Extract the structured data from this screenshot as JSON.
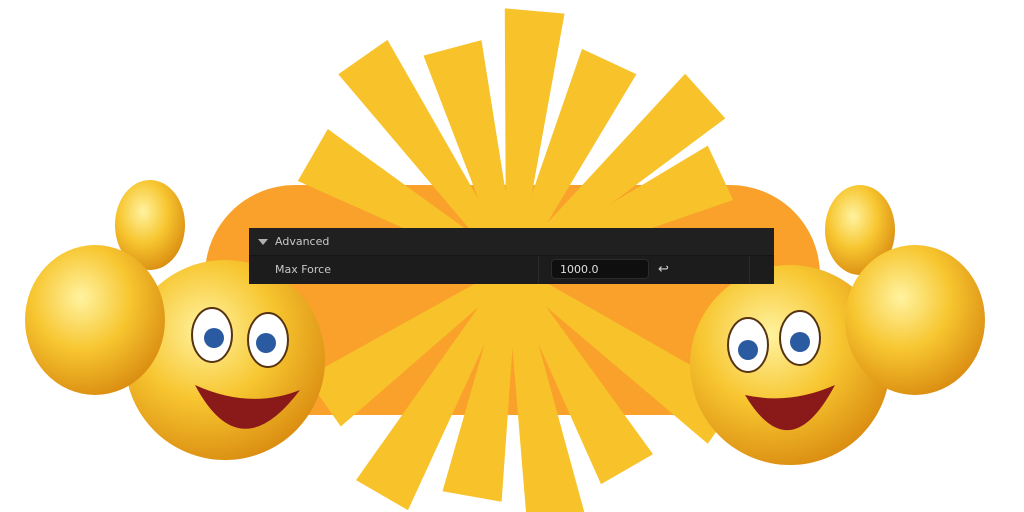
{
  "section": {
    "title": "Advanced",
    "expanded": true
  },
  "property": {
    "label": "Max Force",
    "value": "1000.0",
    "reset_icon": "reset-arrow-icon"
  },
  "colors": {
    "ray": "#f7c22a",
    "glow": "#f9a12a",
    "face": "#f5c63a",
    "panel": "#1a1a1a"
  }
}
